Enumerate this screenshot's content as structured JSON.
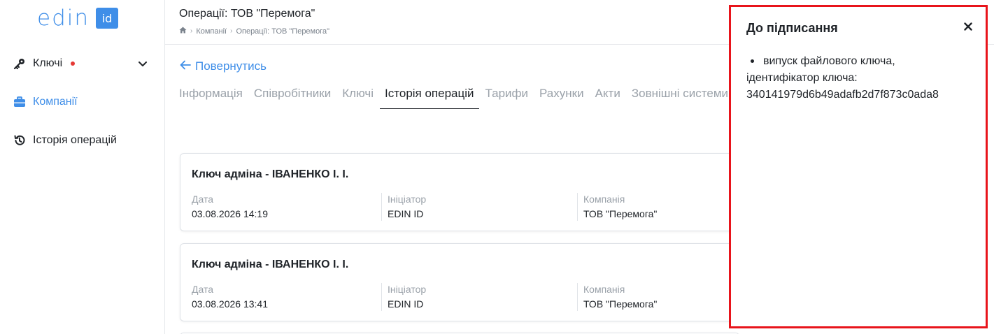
{
  "logo": {
    "text": "edin",
    "badge": "id"
  },
  "sidebar": {
    "items": [
      {
        "label": "Ключі"
      },
      {
        "label": "Компанії"
      },
      {
        "label": "Історія операцій"
      }
    ]
  },
  "header": {
    "title": "Операції: ТОВ \"Перемога\"",
    "breadcrumb": [
      "Компанії",
      "Операції: ТОВ \"Перемога\""
    ]
  },
  "main": {
    "back_label": "Повернутись",
    "tabs": [
      {
        "label": "Інформація"
      },
      {
        "label": "Співробітники"
      },
      {
        "label": "Ключі"
      },
      {
        "label": "Історія операцій"
      },
      {
        "label": "Тарифи"
      },
      {
        "label": "Рахунки"
      },
      {
        "label": "Акти"
      },
      {
        "label": "Зовнішні системи"
      }
    ],
    "field_labels": {
      "date": "Дата",
      "initiator": "Ініціатор",
      "company": "Компанія"
    },
    "cards": [
      {
        "title": "Ключ адміна - ІВАНЕНКО І. І.",
        "date": "03.08.2026 14:19",
        "initiator": "EDIN ID",
        "company": "ТОВ \"Перемога\""
      },
      {
        "title": "Ключ адміна - ІВАНЕНКО І. І.",
        "date": "03.08.2026 13:41",
        "initiator": "EDIN ID",
        "company": "ТОВ \"Перемога\""
      }
    ]
  },
  "panel": {
    "title": "До підписання",
    "items": [
      {
        "line1": "випуск файлового ключа,",
        "line2": "ідентифікатор ключа:",
        "line3": "340141979d6b49adafb2d7f873c0ada8"
      }
    ]
  },
  "colors": {
    "accent": "#3f8ee8",
    "highlight_border": "#e8141b",
    "status_dot": "#e53935"
  }
}
